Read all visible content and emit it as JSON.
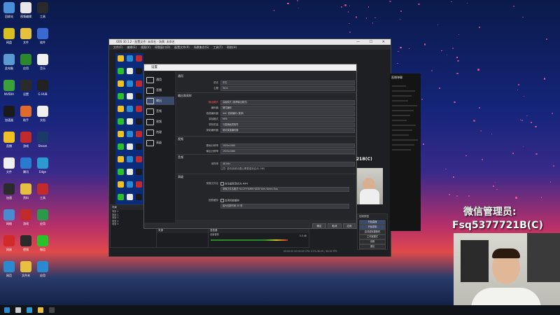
{
  "desktop": {
    "icons": [
      {
        "name": "recycle-bin-icon",
        "label": "回收站",
        "color": "#4a90d9"
      },
      {
        "name": "app-icon-1",
        "label": "视频编辑",
        "color": "#e8e8e8"
      },
      {
        "name": "app-icon-2",
        "label": "工具",
        "color": "#2a2a2a"
      },
      {
        "name": "app-icon-3",
        "label": "网盘",
        "color": "#d8c020"
      },
      {
        "name": "folder-icon",
        "label": "文件",
        "color": "#e8c040"
      },
      {
        "name": "app-icon-4",
        "label": "软件",
        "color": "#3a6ad0"
      },
      {
        "name": "computer-icon",
        "label": "此电脑",
        "color": "#5a9ad0"
      },
      {
        "name": "app-icon-5",
        "label": "应用",
        "color": "#2a8a2a"
      },
      {
        "name": "app-icon-6",
        "label": "音乐",
        "color": "#f0f0f0"
      },
      {
        "name": "nvidia-icon",
        "label": "NVIDIA",
        "color": "#3aa03a"
      },
      {
        "name": "app-icon-7",
        "label": "设置",
        "color": "#2a2a2a"
      },
      {
        "name": "logitech-icon",
        "label": "G HUB",
        "color": "#222"
      },
      {
        "name": "app-icon-8",
        "label": "加速器",
        "color": "#1a1a1a"
      },
      {
        "name": "app-icon-9",
        "label": "助手",
        "color": "#e06a2a"
      },
      {
        "name": "doc-icon",
        "label": "文档",
        "color": "#f0f0f0"
      },
      {
        "name": "app-icon-10",
        "label": "直播",
        "color": "#f0c020"
      },
      {
        "name": "app-icon-11",
        "label": "游戏",
        "color": "#c02a2a"
      },
      {
        "name": "steam-icon",
        "label": "Steam",
        "color": "#1a3a6a"
      },
      {
        "name": "doc-icon-2",
        "label": "文件",
        "color": "#f0f0f0"
      },
      {
        "name": "app-icon-12",
        "label": "腾讯",
        "color": "#2a7ad0"
      },
      {
        "name": "edge-icon",
        "label": "Edge",
        "color": "#2a9ad0"
      },
      {
        "name": "app-icon-13",
        "label": "加速",
        "color": "#2a2a2a"
      },
      {
        "name": "folder-icon-2",
        "label": "资料",
        "color": "#e8c040"
      },
      {
        "name": "app-icon-14",
        "label": "工具",
        "color": "#c02a2a"
      },
      {
        "name": "app-icon-15",
        "label": "网络",
        "color": "#4a8ad0"
      },
      {
        "name": "app-icon-16",
        "label": "游戏",
        "color": "#c02a2a"
      },
      {
        "name": "app-icon-17",
        "label": "应用",
        "color": "#2a9a4a"
      },
      {
        "name": "netease-icon",
        "label": "网易",
        "color": "#d02a2a"
      },
      {
        "name": "app-icon-18",
        "label": "视频",
        "color": "#2a2a2a"
      },
      {
        "name": "wechat-icon",
        "label": "微信",
        "color": "#2ac02a"
      },
      {
        "name": "app-icon-19",
        "label": "网页",
        "color": "#2a8ad0"
      },
      {
        "name": "folder-icon-3",
        "label": "文件夹",
        "color": "#e8c040"
      },
      {
        "name": "app-icon-20",
        "label": "应用",
        "color": "#2a8ad0"
      }
    ]
  },
  "obs": {
    "title": "OBS 30.1.2 - 配置文件: 未命名 - 场景: 未命名",
    "menu": [
      "文件(F)",
      "编辑(E)",
      "视图(V)",
      "停靠窗口(D)",
      "配置文件(P)",
      "场景集合(S)",
      "工具(T)",
      "帮助(H)"
    ],
    "panels": {
      "scenes_header": "场景",
      "scenes": [
        "场景 1",
        "场景 2",
        "场景 3",
        "场景 4",
        "场景 5"
      ],
      "sources_header": "来源",
      "sources_empty": "",
      "mixer_header": "混音器",
      "mixer_item": "桌面音频",
      "mixer_db": "0.0 dB",
      "controls_header": "控制按钮",
      "controls": [
        "开始直播",
        "开始录制",
        "启动虚拟摄像机",
        "工作室模式",
        "设置",
        "退出"
      ]
    },
    "status_text": "00:00:00  00:00:00  CPU: 0.5%  60.00 / 60.00 FPS"
  },
  "settings": {
    "title": "设置",
    "sidebar": [
      {
        "name": "sidebar-item-general",
        "label": "通用",
        "icon": "gear-icon"
      },
      {
        "name": "sidebar-item-stream",
        "label": "直播",
        "icon": "stream-icon"
      },
      {
        "name": "sidebar-item-output",
        "label": "输出",
        "icon": "output-icon",
        "selected": true
      },
      {
        "name": "sidebar-item-audio",
        "label": "音频",
        "icon": "audio-icon"
      },
      {
        "name": "sidebar-item-video",
        "label": "视频",
        "icon": "video-icon"
      },
      {
        "name": "sidebar-item-hotkeys",
        "label": "热键",
        "icon": "keyboard-icon"
      },
      {
        "name": "sidebar-item-advanced",
        "label": "高级",
        "icon": "wrench-icon"
      }
    ],
    "sections": {
      "general_title": "通用",
      "general_rows": [
        {
          "label": "语言",
          "value": "中文"
        },
        {
          "label": "主题",
          "value": "Yami"
        }
      ],
      "output_title": "输出和采样",
      "output_rows": [
        {
          "label": "输出模式",
          "value": "高级模式 (推荐输出模式)",
          "red": true
        },
        {
          "label": "编码器",
          "value": "硬件编码"
        },
        {
          "label": "音频编码器",
          "value": "AAC 音频编码 (推荐)"
        },
        {
          "label": "录制格式",
          "value": "MP4"
        },
        {
          "label": "录制质量",
          "value": "与直播画质相同"
        },
        {
          "label": "录制编码器",
          "value": "使用直播编码器"
        }
      ],
      "video_title": "视频",
      "video_rows": [
        {
          "label": "基础分辨率",
          "value": "1920x1080"
        },
        {
          "label": "输出分辨率",
          "value": "1920x1080"
        }
      ],
      "audio_title": "音频",
      "audio_row_label": "采样率",
      "audio_row_value": "48 kHz",
      "audio_note": "注意: 更改音频设置后需要重新启动 OBS",
      "advanced_title": "高级",
      "adv_rows": [
        {
          "label": "录像文件名",
          "check": "自动重新混合为 MP4",
          "sub": "录像文件名格式 %CCYY-%MM-%DD %hh-%mm-%ss"
        },
        {
          "label": "回放缓存",
          "check": "启用回放缓存",
          "sub": "最大回放时间 20 秒"
        }
      ]
    },
    "buttons": {
      "ok": "确定",
      "cancel": "取消",
      "apply": "应用"
    }
  },
  "chat": {
    "title": "直播弹幕",
    "lines": 14
  },
  "overlay": {
    "wechat_line1": "微信管理员:",
    "wechat_line2": "Fsq5377721B(C)",
    "small_code": "21B(C)"
  },
  "taskbar": {
    "icons": [
      "start-icon",
      "search-icon",
      "edge-icon",
      "folder-icon",
      "obs-icon"
    ]
  }
}
